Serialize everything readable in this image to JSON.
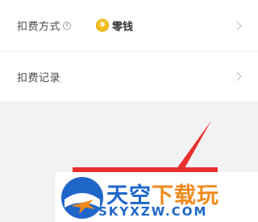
{
  "settings": {
    "deduct_method": {
      "label": "扣费方式",
      "value": "零钱",
      "icon": "coin-icon"
    },
    "deduct_records": {
      "label": "扣费记录"
    }
  },
  "watermark": {
    "brand_blue": "天空",
    "brand_orange": "下载玩",
    "domain": "SKYXZW.COM",
    "colors": {
      "blue": "#1f66c9",
      "orange": "#f08a1c"
    }
  },
  "annotation": {
    "arrow_color": "#e8312f"
  }
}
